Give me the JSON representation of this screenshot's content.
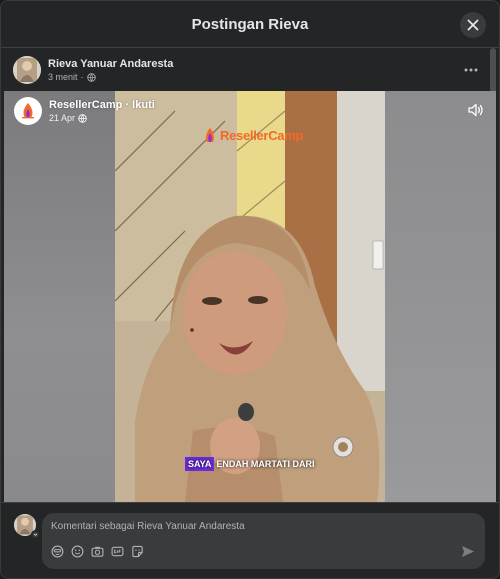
{
  "dialog": {
    "title": "Postingan Rieva"
  },
  "post": {
    "author": "Rieva Yanuar Andaresta",
    "time": "3 menit",
    "separator": "·",
    "privacy_icon": "globe-icon"
  },
  "shared": {
    "page_name": "ResellerCamp",
    "follow_label": "Ikuti",
    "separator": "·",
    "date": "21 Apr",
    "privacy_icon": "globe-icon",
    "brand_watermark": "ResellerCamp",
    "caption_highlight": "SAYA",
    "caption_rest": "ENDAH MARTATI DARI"
  },
  "composer": {
    "placeholder": "Komentari sebagai Rieva Yanuar Andaresta",
    "tools": [
      "avatar-sticker-icon",
      "emoji-icon",
      "camera-icon",
      "gif-icon",
      "sticker-icon"
    ],
    "send_icon": "send-icon"
  },
  "colors": {
    "background": "#242526",
    "input": "#3a3b3c",
    "text": "#e4e6eb",
    "muted": "#b0b3b8",
    "caption_highlight": "#6c2bd9",
    "brand": "#f26a2a"
  }
}
